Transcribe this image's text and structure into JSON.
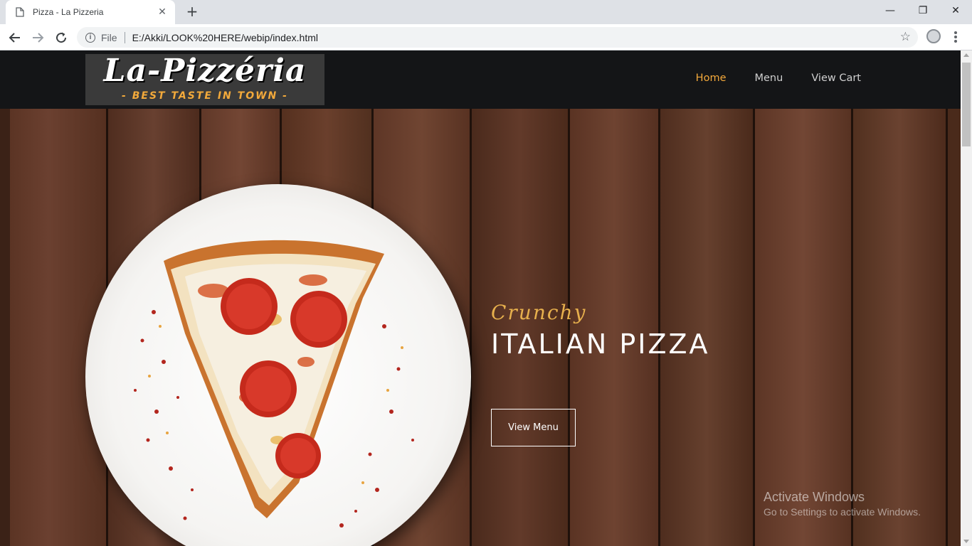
{
  "browser": {
    "tab_title": "Pizza - La Pizzeria",
    "tab_close": "✕",
    "new_tab": "+",
    "window_controls": {
      "minimize": "—",
      "maximize": "❐",
      "close": "✕"
    },
    "url_scheme_label": "File",
    "url": "E:/Akki/LOOK%20HERE/webip/index.html",
    "icons": [
      "page-icon",
      "back-icon",
      "forward-icon",
      "reload-icon",
      "info-icon",
      "star-icon",
      "profile-icon",
      "menu-icon"
    ]
  },
  "site": {
    "logo": {
      "main": "La-Pizzéria",
      "tagline": "- BEST TASTE IN TOWN -"
    },
    "nav": [
      {
        "label": "Home",
        "active": true
      },
      {
        "label": "Menu",
        "active": false
      },
      {
        "label": "View Cart",
        "active": false
      }
    ],
    "hero": {
      "subtitle": "Crunchy",
      "title": "ITALIAN PIZZA",
      "cta_label": "View Menu"
    },
    "accent_color": "#f4a93b"
  },
  "os_watermark": {
    "title": "Activate Windows",
    "subtitle": "Go to Settings to activate Windows."
  }
}
